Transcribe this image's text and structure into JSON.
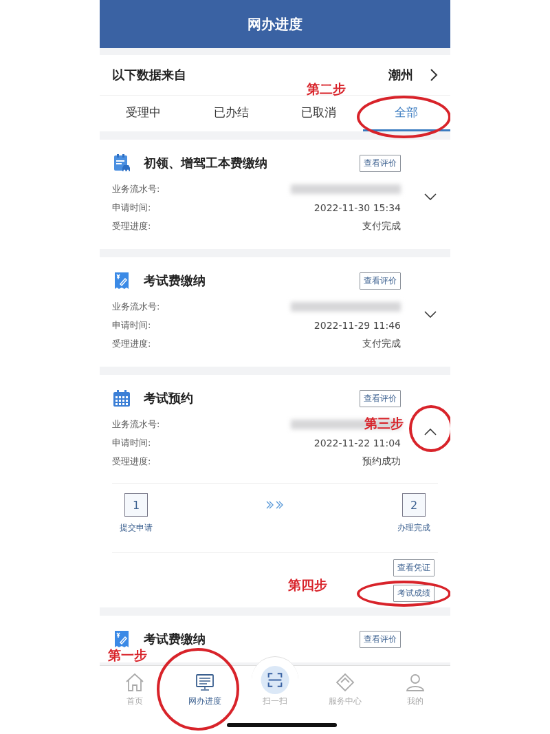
{
  "header": {
    "title": "网办进度"
  },
  "source": {
    "label": "以下数据来自",
    "city": "潮州"
  },
  "tabs": [
    {
      "label": "受理中",
      "selected": false
    },
    {
      "label": "已办结",
      "selected": false
    },
    {
      "label": "已取消",
      "selected": false
    },
    {
      "label": "全部",
      "selected": true,
      "annotation": "第二步"
    }
  ],
  "records": [
    {
      "kind": "car-form",
      "title": "初领、增驾工本费缴纳",
      "review_button": "查看评价",
      "expanded": false,
      "rows": [
        {
          "label": "业务流水号:",
          "kind": "redacted"
        },
        {
          "label": "申请时间:",
          "kind": "text",
          "value": "2022-11-30 15:34"
        },
        {
          "label": "受理进度:",
          "kind": "text",
          "value": "支付完成"
        }
      ]
    },
    {
      "kind": "receipt",
      "title": "考试费缴纳",
      "review_button": "查看评价",
      "expanded": false,
      "rows": [
        {
          "label": "业务流水号:",
          "kind": "redacted"
        },
        {
          "label": "申请时间:",
          "kind": "text",
          "value": "2022-11-29 11:46"
        },
        {
          "label": "受理进度:",
          "kind": "text",
          "value": "支付完成"
        }
      ]
    },
    {
      "kind": "calendar",
      "title": "考试预约",
      "review_button": "查看评价",
      "expanded": true,
      "chevron_annotation": "第三步",
      "rows": [
        {
          "label": "业务流水号:",
          "kind": "redacted"
        },
        {
          "label": "申请时间:",
          "kind": "text",
          "value": "2022-11-22 11:04"
        },
        {
          "label": "受理进度:",
          "kind": "text",
          "value": "预约成功"
        }
      ],
      "steps": [
        {
          "number": "1",
          "label": "提交申请"
        },
        {
          "number": "2",
          "label": "办理完成"
        }
      ],
      "actions": [
        {
          "label": "查看凭证"
        },
        {
          "label": "考试成绩",
          "annotation": "第四步"
        }
      ]
    },
    {
      "kind": "receipt",
      "title": "考试费缴纳",
      "review_button": "查看评价"
    }
  ],
  "nav": [
    {
      "kind": "home",
      "label": "首页",
      "selected": false
    },
    {
      "kind": "monitor",
      "label": "网办进度",
      "selected": true,
      "annotation": "第一步"
    },
    {
      "kind": "scan",
      "label": "扫一扫",
      "selected": false
    },
    {
      "kind": "service",
      "label": "服务中心",
      "selected": false
    },
    {
      "kind": "person",
      "label": "我的",
      "selected": false
    }
  ]
}
